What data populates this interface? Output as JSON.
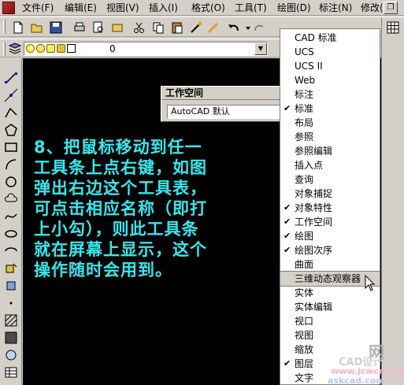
{
  "menubar": {
    "items": [
      {
        "label": "文件(F)"
      },
      {
        "label": "编辑(E)"
      },
      {
        "label": "视图(V)"
      },
      {
        "label": "插入(I)"
      },
      {
        "label": "格式(O)"
      },
      {
        "label": "工具(T)"
      },
      {
        "label": "绘图(D)"
      },
      {
        "label": "标注(N)"
      },
      {
        "label": "修改(M)"
      }
    ],
    "restore_glyph": "❐"
  },
  "layer_toolbar": {
    "current_layer": "0",
    "dropdown_glyph": "▼"
  },
  "workspace_panel": {
    "title": "工作空间",
    "value": "AutoCAD 默认"
  },
  "instruction": {
    "text": "8、把鼠标移动到任一\n工具条上点右键，如图\n弹出右边这个工具表，\n可点击相应名称（即打\n上小勾），则此工具条\n就在屏幕上显示，这个\n操作随时会用到。"
  },
  "context_menu": {
    "items": [
      {
        "label": "CAD 标准",
        "checked": false
      },
      {
        "label": "UCS",
        "checked": false
      },
      {
        "label": "UCS II",
        "checked": false
      },
      {
        "label": "Web",
        "checked": false
      },
      {
        "label": "标注",
        "checked": false
      },
      {
        "label": "标准",
        "checked": true
      },
      {
        "label": "布局",
        "checked": false
      },
      {
        "label": "参照",
        "checked": false
      },
      {
        "label": "参照编辑",
        "checked": false
      },
      {
        "label": "插入点",
        "checked": false
      },
      {
        "label": "查询",
        "checked": false
      },
      {
        "label": "对象捕捉",
        "checked": false
      },
      {
        "label": "对象特性",
        "checked": true
      },
      {
        "label": "工作空间",
        "checked": true
      },
      {
        "label": "绘图",
        "checked": true
      },
      {
        "label": "绘图次序",
        "checked": true
      },
      {
        "label": "曲面",
        "checked": false
      },
      {
        "label": "三维动态观察器",
        "checked": false,
        "highlighted": true
      },
      {
        "label": "实体",
        "checked": false
      },
      {
        "label": "实体编辑",
        "checked": false
      },
      {
        "label": "视口",
        "checked": false
      },
      {
        "label": "视图",
        "checked": false
      },
      {
        "label": "缩放",
        "checked": false
      },
      {
        "label": "图层",
        "checked": true
      },
      {
        "label": "文字",
        "checked": false
      }
    ],
    "check_glyph": "✔"
  },
  "watermark": {
    "cn": "网",
    "cad": "CAD设计论坛",
    "url1": "www.jcwcn.com",
    "url2": "askcad.com"
  },
  "colors": {
    "instruction_text": "#35e8ee",
    "canvas": "#000000",
    "chrome": "#d4d0c8"
  }
}
